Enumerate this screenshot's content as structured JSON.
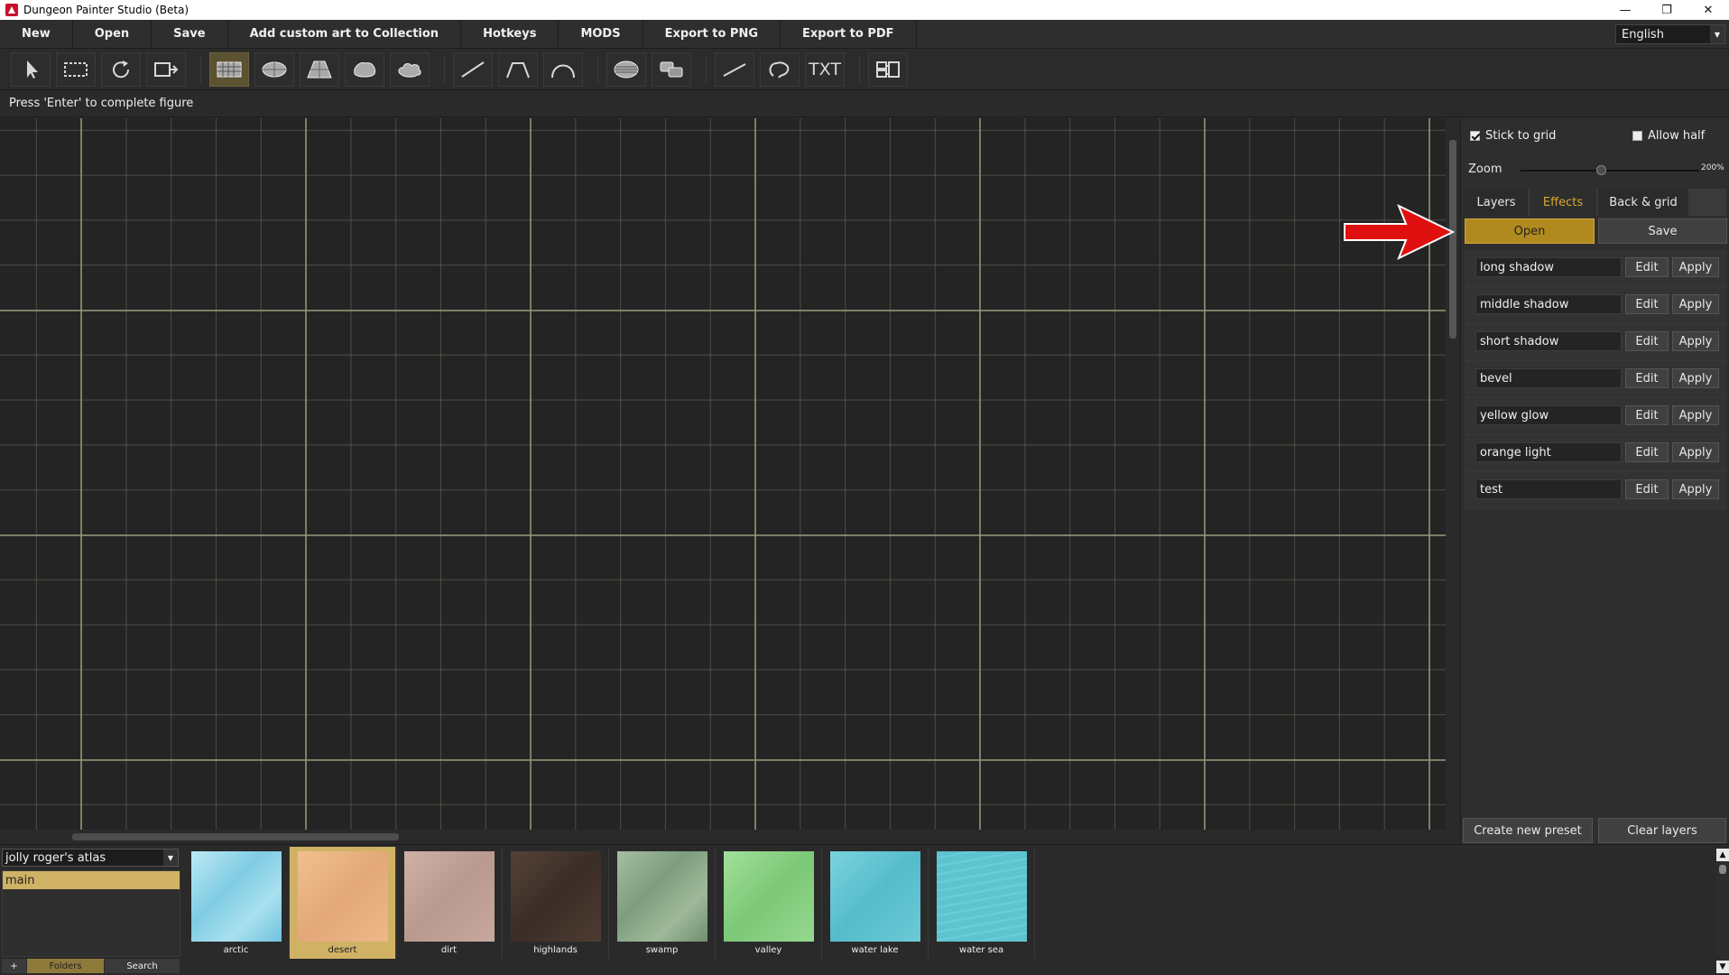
{
  "window": {
    "title": "Dungeon Painter Studio (Beta)",
    "controls": [
      "—",
      "❐",
      "✕"
    ]
  },
  "menu": {
    "items": [
      "New",
      "Open",
      "Save",
      "Add custom art to Collection",
      "Hotkeys",
      "MODS",
      "Export to PNG",
      "Export to PDF"
    ],
    "language": "English"
  },
  "toolbar": {
    "tools": [
      "select-arrow-icon",
      "rect-select-icon",
      "rotate-icon",
      "move-to-icon",
      "grid-room-icon",
      "ellipse-room-icon",
      "trapezoid-room-icon",
      "blob-room-icon",
      "cloud-room-icon",
      "line-wall-icon",
      "polyline-wall-icon",
      "arc-wall-icon",
      "layer-stack-icon",
      "merge-shapes-icon",
      "line-path-icon",
      "freeform-path-icon",
      "text-icon",
      "grid-map-icon"
    ],
    "text_tool_label": "TXT",
    "active_tool": "grid-room-icon"
  },
  "status": {
    "hint": "Press 'Enter' to complete figure"
  },
  "right_panel": {
    "stick_to_grid": {
      "label": "Stick to grid",
      "checked": true
    },
    "allow_half": {
      "label": "Allow half",
      "checked": false
    },
    "zoom": {
      "label": "Zoom",
      "value": "200%",
      "level_fraction": 0.45
    },
    "tabs": [
      "Layers",
      "Effects",
      "Back & grid"
    ],
    "active_tab": "Effects",
    "open_label": "Open",
    "save_label": "Save",
    "presets": [
      {
        "name": "long shadow",
        "edit": "Edit",
        "apply": "Apply"
      },
      {
        "name": "middle shadow",
        "edit": "Edit",
        "apply": "Apply"
      },
      {
        "name": "short shadow",
        "edit": "Edit",
        "apply": "Apply"
      },
      {
        "name": "bevel",
        "edit": "Edit",
        "apply": "Apply"
      },
      {
        "name": "yellow glow",
        "edit": "Edit",
        "apply": "Apply"
      },
      {
        "name": "orange light",
        "edit": "Edit",
        "apply": "Apply"
      },
      {
        "name": "test",
        "edit": "Edit",
        "apply": "Apply"
      }
    ],
    "create_preset_label": "Create new preset",
    "clear_layers_label": "Clear layers"
  },
  "bottom_panel": {
    "collection": "jolly roger's atlas",
    "folders": [
      "main"
    ],
    "tabs": [
      "+",
      "Folders",
      "Search"
    ],
    "active_tab": "Folders",
    "textures": [
      {
        "label": "arctic",
        "color": "#8fd6ea",
        "selected": false
      },
      {
        "label": "desert",
        "color": "#e8b07e",
        "selected": true
      },
      {
        "label": "dirt",
        "color": "#c4a49a",
        "selected": false
      },
      {
        "label": "highlands",
        "color": "#4a3a32",
        "selected": false
      },
      {
        "label": "swamp",
        "color": "#8fae8e",
        "selected": false
      },
      {
        "label": "valley",
        "color": "#8ed48a",
        "selected": false
      },
      {
        "label": "water lake",
        "color": "#66c8d6",
        "selected": false
      },
      {
        "label": "water sea",
        "color": "#5cc4cf",
        "selected": false
      }
    ]
  },
  "colors": {
    "accent": "#b08a1e",
    "active_tab_text": "#d9a830",
    "arrow": "#e01010"
  }
}
